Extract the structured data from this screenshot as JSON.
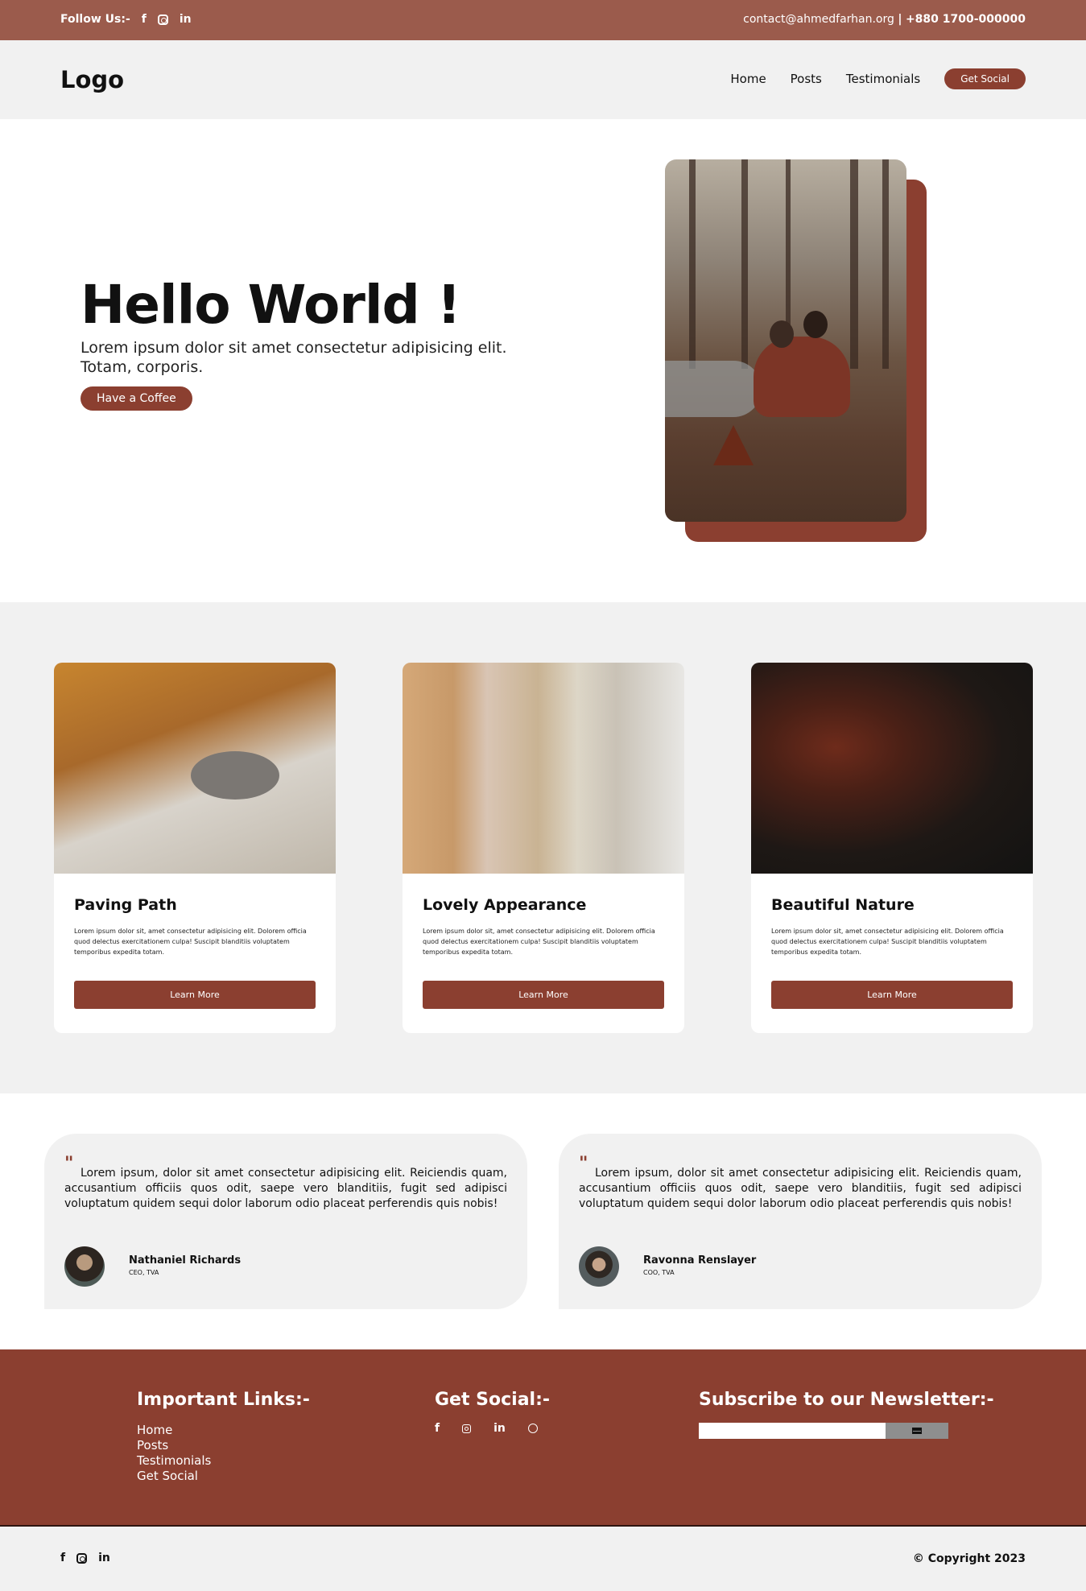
{
  "topbar": {
    "follow_label": "Follow Us:-",
    "email": "contact@ahmedfarhan.org",
    "separator": "|",
    "phone": "+880 1700-000000",
    "social_icons": [
      "facebook-icon",
      "instagram-icon",
      "linkedin-icon"
    ]
  },
  "header": {
    "logo": "Logo",
    "nav": [
      "Home",
      "Posts",
      "Testimonials"
    ],
    "cta": "Get Social"
  },
  "hero": {
    "title": "Hello World !",
    "text": "Lorem ipsum dolor sit amet consectetur adipisicing elit. Totam, corporis.",
    "button": "Have a Coffee"
  },
  "cards": [
    {
      "title": "Paving Path",
      "text": "Lorem ipsum dolor sit, amet consectetur adipisicing elit. Dolorem officia quod delectus exercitationem culpa! Suscipit blanditiis voluptatem temporibus expedita totam.",
      "button": "Learn More"
    },
    {
      "title": "Lovely Appearance",
      "text": "Lorem ipsum dolor sit, amet consectetur adipisicing elit. Dolorem officia quod delectus exercitationem culpa! Suscipit blanditiis voluptatem temporibus expedita totam.",
      "button": "Learn More"
    },
    {
      "title": "Beautiful Nature",
      "text": "Lorem ipsum dolor sit, amet consectetur adipisicing elit. Dolorem officia quod delectus exercitationem culpa! Suscipit blanditiis voluptatem temporibus expedita totam.",
      "button": "Learn More"
    }
  ],
  "testimonials": [
    {
      "quote_mark": "\"",
      "text": "Lorem ipsum, dolor sit amet consectetur adipisicing elit. Reiciendis quam, accusantium officiis quos odit, saepe vero blanditiis, fugit sed adipisci voluptatum quidem sequi dolor laborum odio placeat perferendis quis nobis!",
      "name": "Nathaniel Richards",
      "role": "CEO, TVA"
    },
    {
      "quote_mark": "\"",
      "text": "Lorem ipsum, dolor sit amet consectetur adipisicing elit. Reiciendis quam, accusantium officiis quos odit, saepe vero blanditiis, fugit sed adipisci voluptatum quidem sequi dolor laborum odio placeat perferendis quis nobis!",
      "name": "Ravonna Renslayer",
      "role": "COO, TVA"
    }
  ],
  "footer": {
    "links_title": "Important Links:-",
    "links": [
      "Home",
      "Posts",
      "Testimonials",
      "Get Social"
    ],
    "social_title": "Get Social:-",
    "social_icons": [
      "facebook-icon",
      "instagram-icon",
      "linkedin-icon",
      "dribbble-icon"
    ],
    "newsletter_title": "Subscribe to our Newsletter:-",
    "newsletter_value": ""
  },
  "bottombar": {
    "copyright": "© Copyright 2023",
    "social_icons": [
      "facebook-icon",
      "instagram-icon",
      "linkedin-icon"
    ]
  },
  "colors": {
    "topbar": "#9b5b4c",
    "accent": "#8b3f30",
    "light_bg": "#f1f1f1"
  }
}
